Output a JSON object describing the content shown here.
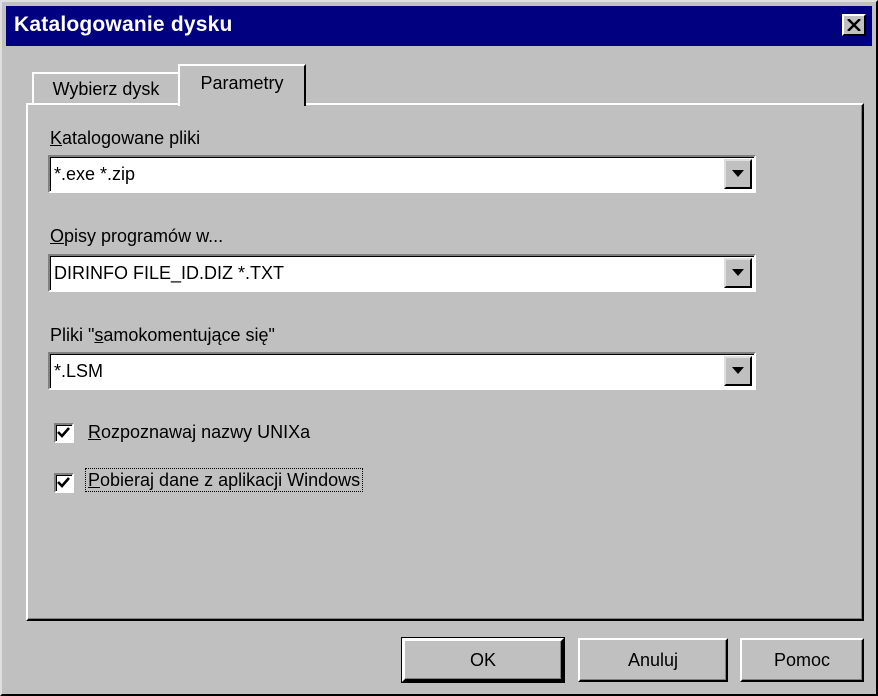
{
  "window": {
    "title": "Katalogowanie dysku"
  },
  "tabs": [
    {
      "label": "Wybierz dysk",
      "active": false
    },
    {
      "label": "Parametry",
      "active": true
    }
  ],
  "fields": {
    "cataloged_files": {
      "label_key": "K",
      "label_rest": "atalogowane pliki",
      "value": "*.exe *.zip"
    },
    "program_desc": {
      "label_key": "O",
      "label_rest": "pisy programów w...",
      "value": "DIRINFO FILE_ID.DIZ *.TXT"
    },
    "self_comment": {
      "label_pre": "Pliki \"",
      "label_key": "s",
      "label_rest": "amokomentujące się\"",
      "value": "*.LSM"
    }
  },
  "checkboxes": {
    "unix_names": {
      "label_key": "R",
      "label_rest": "ozpoznawaj nazwy UNIXa",
      "checked": true
    },
    "windows_data": {
      "label_key": "P",
      "label_rest": "obieraj dane z aplikacji Windows",
      "checked": true
    }
  },
  "buttons": {
    "ok": "OK",
    "cancel": "Anuluj",
    "help": "Pomoc"
  }
}
